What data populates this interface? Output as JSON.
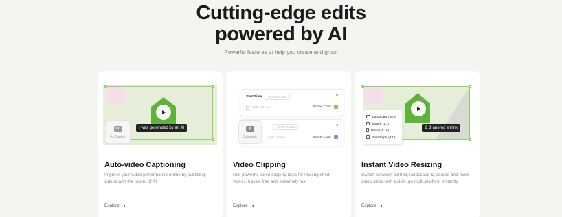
{
  "hero": {
    "title_line1": "Cutting-edge edits",
    "title_line2": "powered by AI",
    "subtitle": "Powerful features to help you create and grow."
  },
  "cards": [
    {
      "title": "Auto-video Captioning",
      "description": "Improve your video performance online by subtitling videos with the power of AI",
      "link": "Explore",
      "media": {
        "tooltip": "I was generated by an AI",
        "mini_card_label": "AI Caption"
      }
    },
    {
      "title": "Video Clipping",
      "description": "Use powerful video clipping tools for making short videos, hassle free and extremely fast",
      "link": "Explore",
      "media": {
        "row1_label": "Start Time",
        "row1_time": "00:00:04.000",
        "row1_value": "0",
        "row2_checkbox": "Split Screen",
        "row2_color_label": "Scene Color",
        "row3_time": "00:00:08.283",
        "row3_value": "0",
        "row4_checkbox": "Split Screen",
        "row4_color_label": "Scene Color",
        "mini_card_label": "Cutmagic",
        "color_green": "#7ccf57",
        "color_purple": "#8a8cd8"
      }
    },
    {
      "title": "Instant Video Resizing",
      "description": "Switch between portrait, landscape &, square and more video sizes with a click, go multi-platform instantly",
      "link": "Explore",
      "media": {
        "tooltip": "2, 1 anored shrink",
        "ratios": [
          "Landscape (16:9)",
          "Square (1:1)",
          "Potrait (9:16)",
          "Potrait Split (9:16)"
        ]
      }
    }
  ],
  "colors": {
    "accent_green": "#8fd16a",
    "house_green": "#5fb33a",
    "pink": "#f7dcea",
    "background": "#f4f4f1"
  },
  "icons": {
    "play": "play-icon",
    "chevron": "chevron-right-icon"
  }
}
